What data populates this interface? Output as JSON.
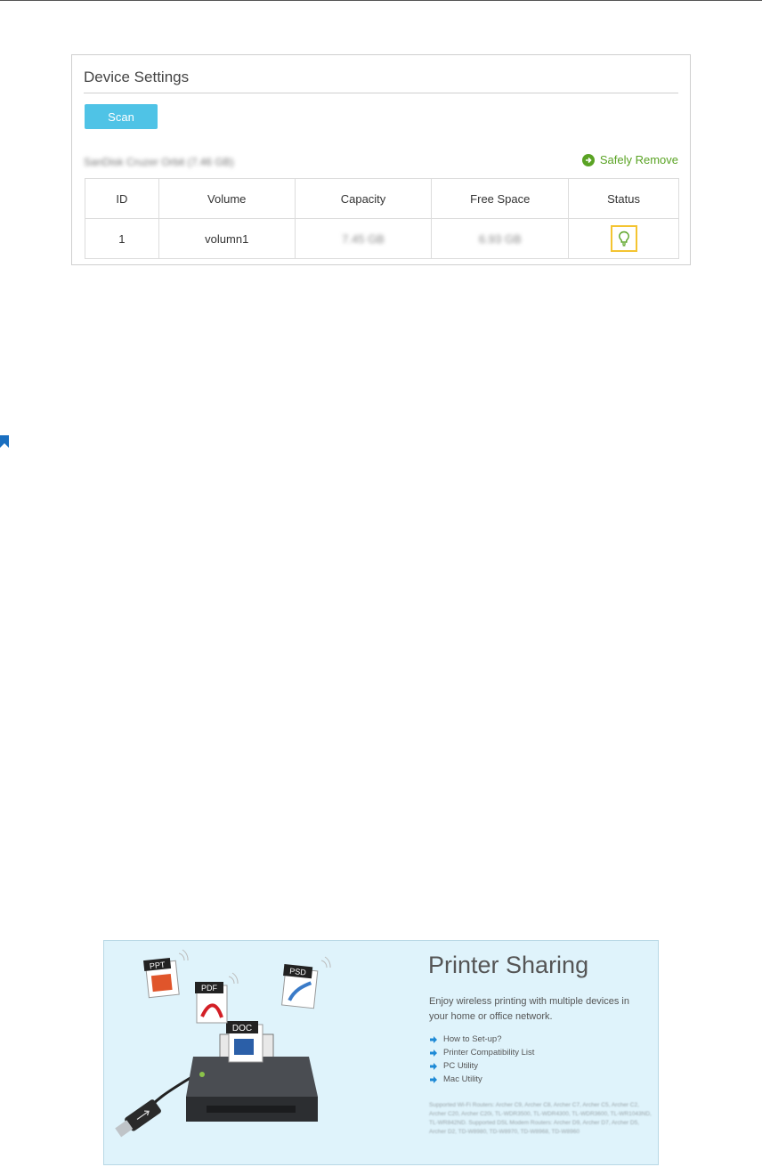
{
  "device_settings": {
    "title": "Device Settings",
    "scan_label": "Scan",
    "device_name": "SanDisk Cruzer Orbit (7.46 GB)",
    "safely_remove_label": "Safely Remove",
    "table": {
      "headers": [
        "ID",
        "Volume",
        "Capacity",
        "Free Space",
        "Status"
      ],
      "rows": [
        {
          "id": "1",
          "volume": "volumn1",
          "capacity": "7.45 GB",
          "free_space": "6.93 GB",
          "status_icon": "lightbulb-icon"
        }
      ]
    },
    "colors": {
      "scan_button": "#4fc3e6",
      "safely_remove": "#5aa324",
      "status_highlight": "#f4c431"
    }
  },
  "printer_sharing": {
    "title": "Printer Sharing",
    "description": "Enjoy wireless printing with multiple devices in your home or office network.",
    "links": [
      "How to Set-up?",
      "Printer Compatibility List",
      "PC Utility",
      "Mac Utility"
    ],
    "supported_text": "Supported Wi-Fi Routers: Archer C9, Archer C8, Archer C7, Archer C5, Archer C2, Archer C20, Archer C20i, TL-WDR3500, TL-WDR4300, TL-WDR3600, TL-WR1043ND, TL-WR842ND. Supported DSL Modem Routers: Archer D9, Archer D7, Archer D5, Archer D2, TD-W8980, TD-W8970, TD-W8968, TD-W8960",
    "file_labels": [
      "PPT",
      "PDF",
      "PSD",
      "DOC"
    ],
    "background_color": "#dff3fb"
  }
}
